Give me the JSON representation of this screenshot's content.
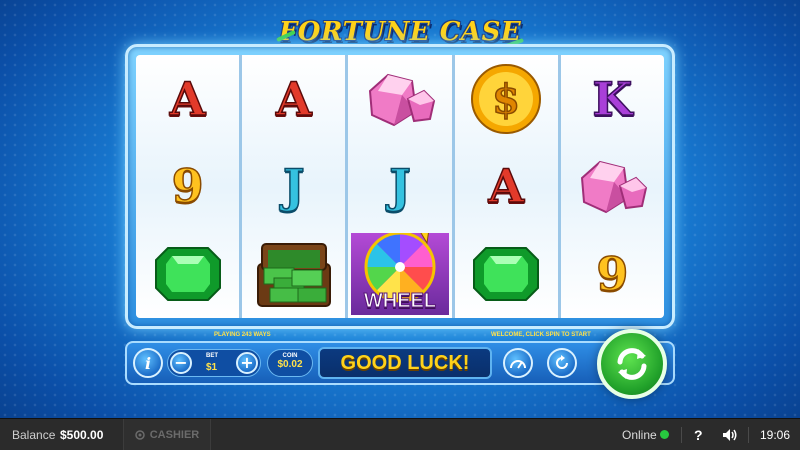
{
  "game": {
    "title": "FORTUNE CASE",
    "ways_text": "PLAYING 243 WAYS",
    "welcome_text": "WELCOME, CLICK SPIN TO START",
    "message": "GOOD LUCK!",
    "bet_label": "BET",
    "bet_value": "$1",
    "coin_label": "COIN",
    "coin_value": "$0.02",
    "wheel_label": "WHEEL"
  },
  "reels": [
    [
      "A",
      "9",
      "emerald"
    ],
    [
      "A",
      "J",
      "money-case"
    ],
    [
      "pink-gem",
      "J",
      "wheel"
    ],
    [
      "dollar-coin",
      "A",
      "emerald"
    ],
    [
      "K",
      "pink-gem",
      "9"
    ]
  ],
  "status": {
    "balance_label": "Balance",
    "balance_value": "$500.00",
    "cashier_label": "CASHIER",
    "online_label": "Online",
    "help_label": "?",
    "time": "19:06"
  },
  "colors": {
    "online": "#27c93f",
    "spin": "#21a12a",
    "message": "#ffd21a"
  }
}
